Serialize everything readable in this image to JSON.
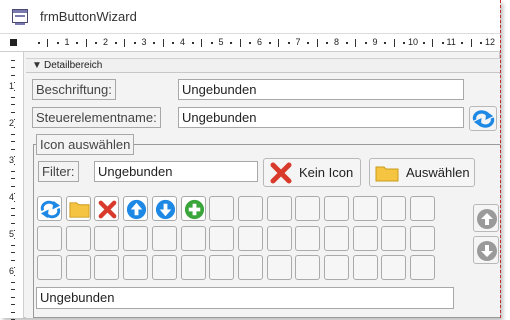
{
  "window": {
    "title": "frmButtonWizard"
  },
  "ruler": {
    "h_numbers": [
      "1",
      "2",
      "3",
      "4",
      "5",
      "6",
      "7",
      "8",
      "9",
      "10",
      "11",
      "12"
    ],
    "v_numbers": [
      "1",
      "2",
      "3",
      "4",
      "5",
      "6"
    ]
  },
  "section": {
    "label": "Detailbereich"
  },
  "form": {
    "caption_label": "Beschriftung:",
    "caption_value": "Ungebunden",
    "name_label": "Steuerelementname:",
    "name_value": "Ungebunden"
  },
  "icon_group": {
    "title": "Icon auswählen",
    "filter_label": "Filter:",
    "filter_value": "Ungebunden",
    "no_icon_label": "Kein Icon",
    "select_label": "Auswählen",
    "grid_icons": [
      "refresh-icon",
      "folder-icon",
      "delete-icon",
      "arrow-up-icon",
      "arrow-down-icon",
      "add-icon"
    ],
    "bottom_field_value": "Ungebunden"
  },
  "colors": {
    "accent_blue": "#1e88e5",
    "folder_yellow": "#f5c542",
    "delete_red": "#d83b2b",
    "add_green": "#3aa53a",
    "disabled_gray": "#9a9a9a"
  }
}
